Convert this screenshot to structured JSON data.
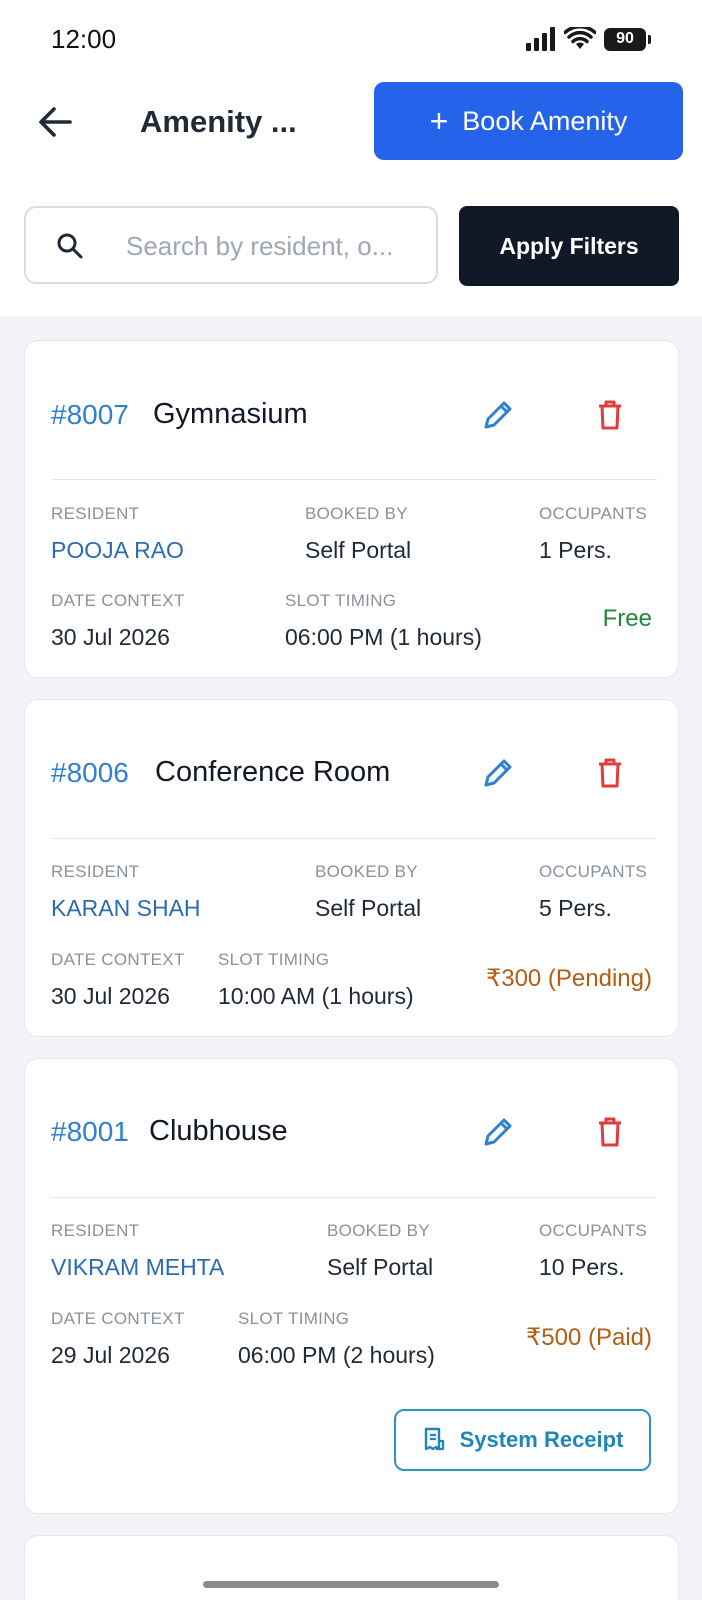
{
  "status": {
    "time": "12:00",
    "battery": "90"
  },
  "header": {
    "title": "Amenity ...",
    "book_label": "Book Amenity"
  },
  "filters": {
    "search_placeholder": "Search by resident, o...",
    "apply_label": "Apply Filters"
  },
  "labels": {
    "resident": "RESIDENT",
    "booked_by": "BOOKED BY",
    "occupants": "OCCUPANTS",
    "date_context": "DATE CONTEXT",
    "slot_timing": "SLOT TIMING"
  },
  "bookings": [
    {
      "id": "#8007",
      "name": "Gymnasium",
      "resident": "POOJA RAO",
      "booked_by": "Self Portal",
      "occupants": "1 Pers.",
      "date": "30 Jul 2026",
      "slot": "06:00 PM (1 hours)",
      "amount": "Free",
      "amount_color": "#1f8a3c"
    },
    {
      "id": "#8006",
      "name": "Conference Room",
      "resident": "KARAN SHAH",
      "booked_by": "Self Portal",
      "occupants": "5 Pers.",
      "date": "30 Jul 2026",
      "slot": "10:00 AM (1 hours)",
      "amount": "₹300 (Pending)",
      "amount_color": "#b35c12"
    },
    {
      "id": "#8001",
      "name": "Clubhouse",
      "resident": "VIKRAM MEHTA",
      "booked_by": "Self Portal",
      "occupants": "10 Pers.",
      "date": "29 Jul 2026",
      "slot": "06:00 PM (2 hours)",
      "amount": "₹500 (Paid)",
      "amount_color": "#b35c12",
      "receipt_label": "System Receipt"
    }
  ],
  "colors": {
    "primary": "#2563eb",
    "dark": "#111827",
    "id_blue": "#2f80d1",
    "danger": "#e03c3c"
  }
}
